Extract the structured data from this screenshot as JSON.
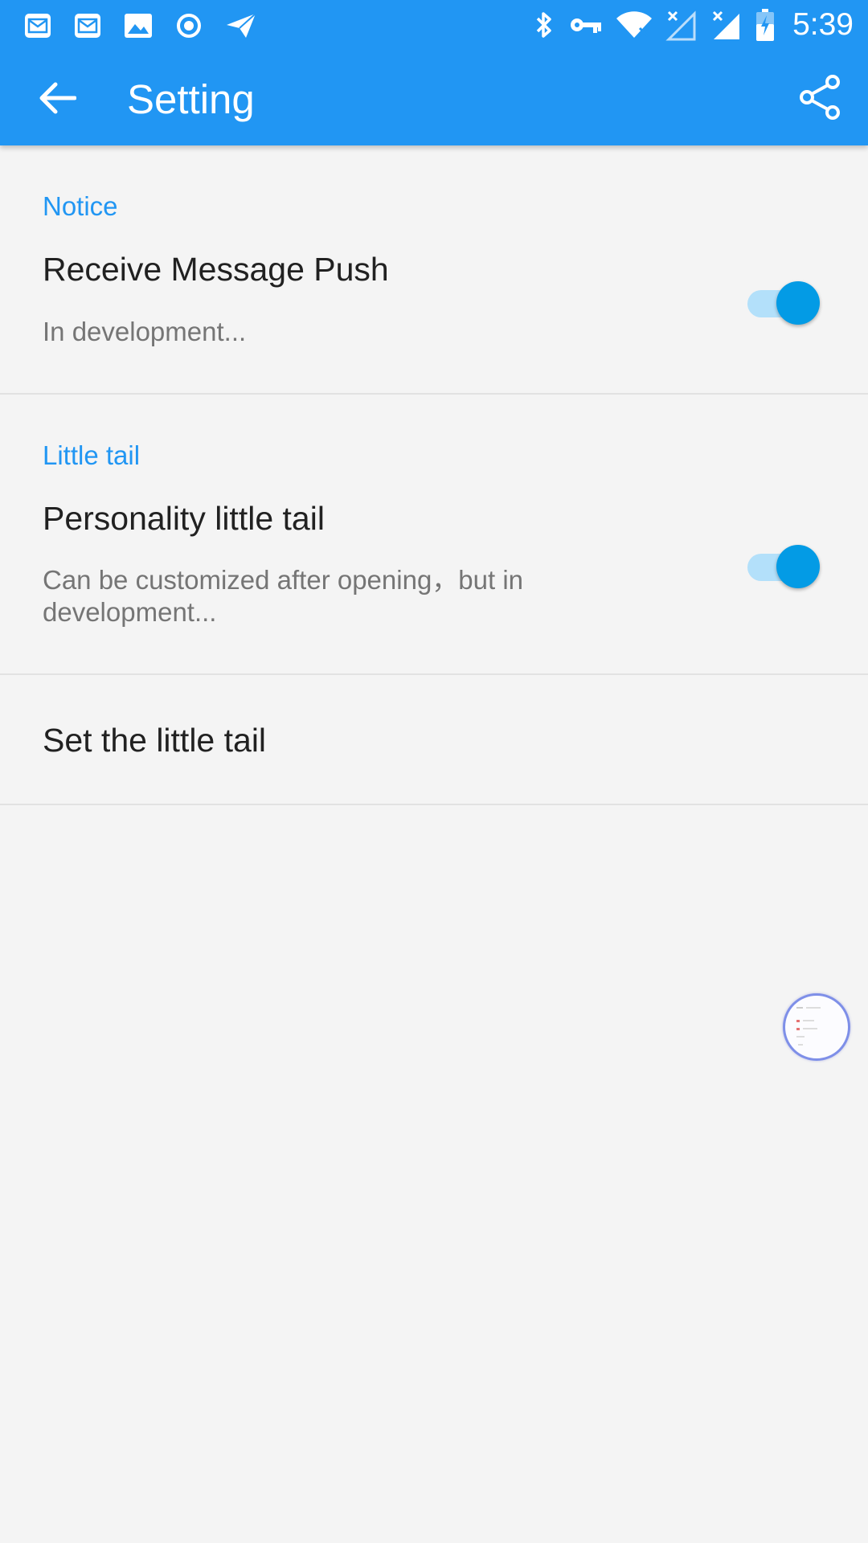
{
  "status_bar": {
    "time": "5:39",
    "left_icons": [
      "mail-icon",
      "mail-icon",
      "image-icon",
      "record-icon",
      "send-icon"
    ],
    "right_icons": [
      "bluetooth-icon",
      "key-icon",
      "wifi-icon",
      "signal-empty-icon",
      "signal-icon",
      "battery-charging-icon"
    ]
  },
  "header": {
    "title": "Setting",
    "back_icon": "arrow-back-icon",
    "share_icon": "share-icon"
  },
  "settings": {
    "notice": {
      "header": "Notice",
      "title": "Receive Message Push",
      "subtitle": "In development...",
      "enabled": true
    },
    "little_tail": {
      "header": "Little tail",
      "title": "Personality little tail",
      "subtitle": "Can be customized after opening，but in development...",
      "enabled": true
    },
    "set_tail": {
      "title": "Set the little tail"
    }
  },
  "colors": {
    "primary": "#2196f3",
    "accent": "#039be5",
    "background": "#f4f4f4"
  }
}
